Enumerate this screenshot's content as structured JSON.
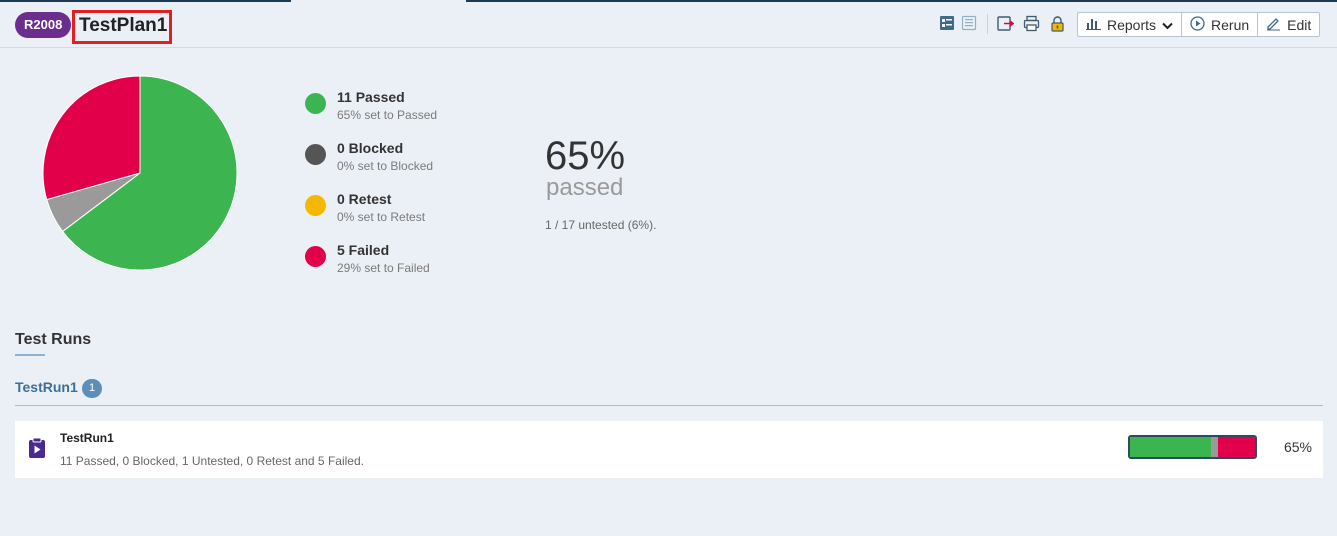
{
  "plan": {
    "id_badge": "R2008",
    "title": "TestPlan1"
  },
  "toolbar": {
    "reports_label": "Reports",
    "rerun_label": "Rerun",
    "edit_label": "Edit"
  },
  "colors": {
    "passed": "#3cb550",
    "blocked": "#555555",
    "retest": "#f5b800",
    "failed": "#e2004a",
    "untested": "#9a9a9a"
  },
  "legend": [
    {
      "title": "11 Passed",
      "sub": "65% set to Passed",
      "status": "passed"
    },
    {
      "title": "0 Blocked",
      "sub": "0% set to Blocked",
      "status": "blocked"
    },
    {
      "title": "0 Retest",
      "sub": "0% set to Retest",
      "status": "retest"
    },
    {
      "title": "5 Failed",
      "sub": "29% set to Failed",
      "status": "failed"
    }
  ],
  "chart_data": {
    "type": "pie",
    "slices": [
      {
        "label": "Passed",
        "value": 11
      },
      {
        "label": "Untested",
        "value": 1
      },
      {
        "label": "Failed",
        "value": 5
      }
    ]
  },
  "summary": {
    "percent": "65%",
    "label": "passed",
    "untested_text": "1 / 17 untested (6%)."
  },
  "test_runs": {
    "section_title": "Test Runs",
    "group_name": "TestRun1",
    "group_count": "1",
    "runs": [
      {
        "name": "TestRun1",
        "description": "11 Passed, 0 Blocked, 1 Untested, 0 Retest and 5 Failed.",
        "percent": "65%",
        "progress": [
          {
            "status": "passed",
            "value": 11
          },
          {
            "status": "untested",
            "value": 1
          },
          {
            "status": "failed",
            "value": 5
          }
        ]
      }
    ]
  }
}
